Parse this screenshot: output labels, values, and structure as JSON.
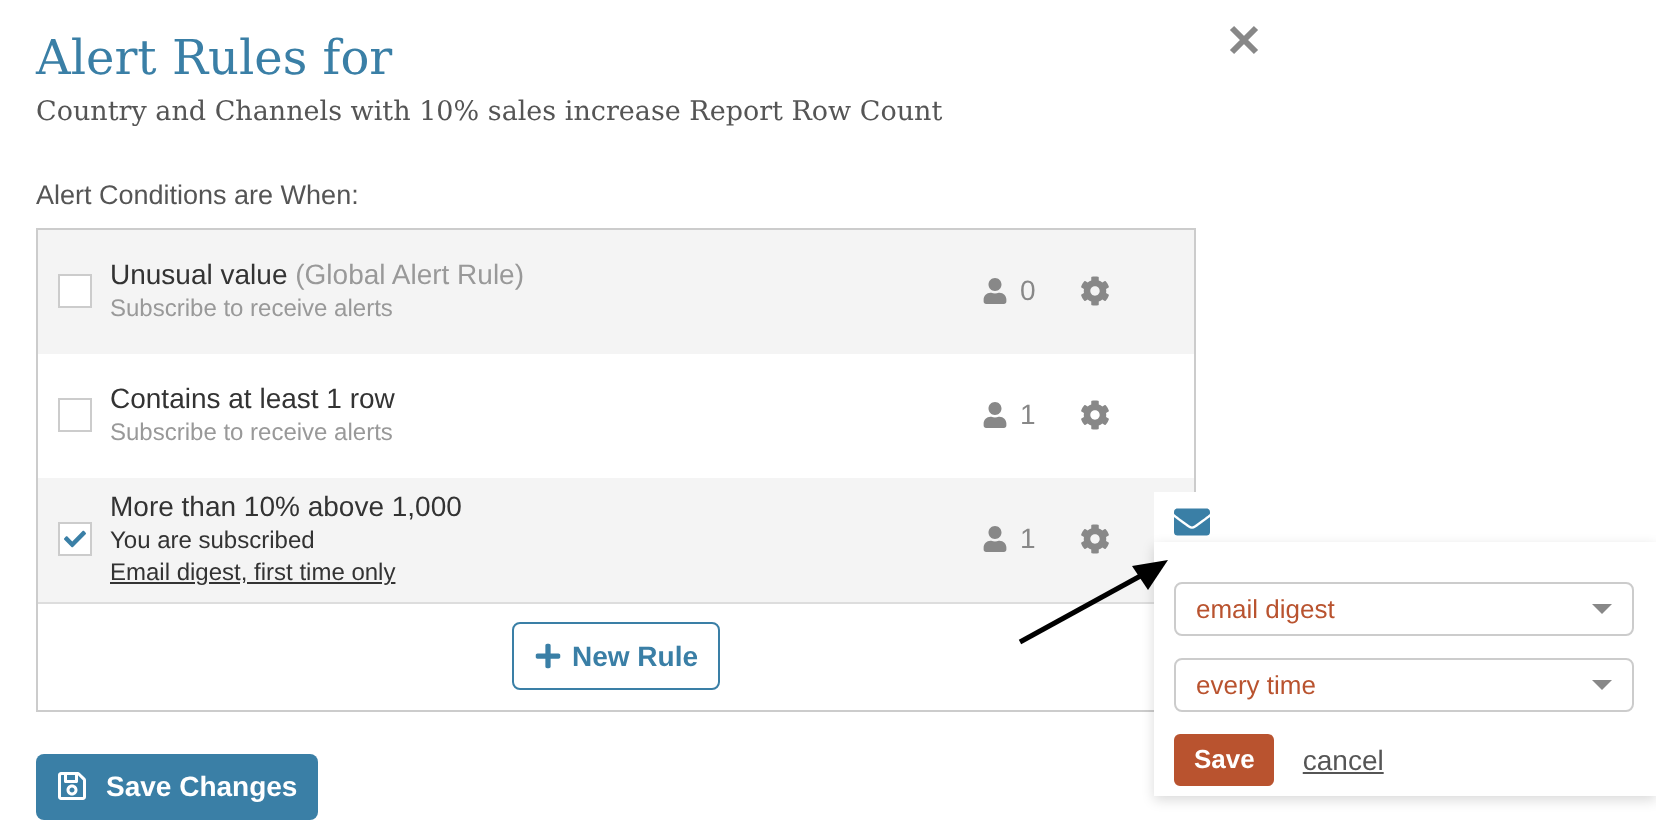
{
  "title": "Alert Rules for",
  "subtitle": "Country and Channels with 10% sales increase Report Row Count",
  "conditions_label": "Alert Conditions are When:",
  "rules": [
    {
      "name": "Unusual value",
      "tag": "(Global Alert Rule)",
      "status": "Subscribe to receive alerts",
      "subscribers": "0",
      "checked": false
    },
    {
      "name": "Contains at least 1 row",
      "status": "Subscribe to receive alerts",
      "subscribers": "1",
      "checked": false
    },
    {
      "name": "More than 10% above 1,000",
      "status": "You are subscribed",
      "link": "Email digest, first time only",
      "subscribers": "1",
      "checked": true
    }
  ],
  "new_rule_button": "New Rule",
  "save_changes_button": "Save Changes",
  "popup": {
    "delivery": "email digest",
    "frequency": "every time",
    "save_button": "Save",
    "cancel_link": "cancel"
  }
}
